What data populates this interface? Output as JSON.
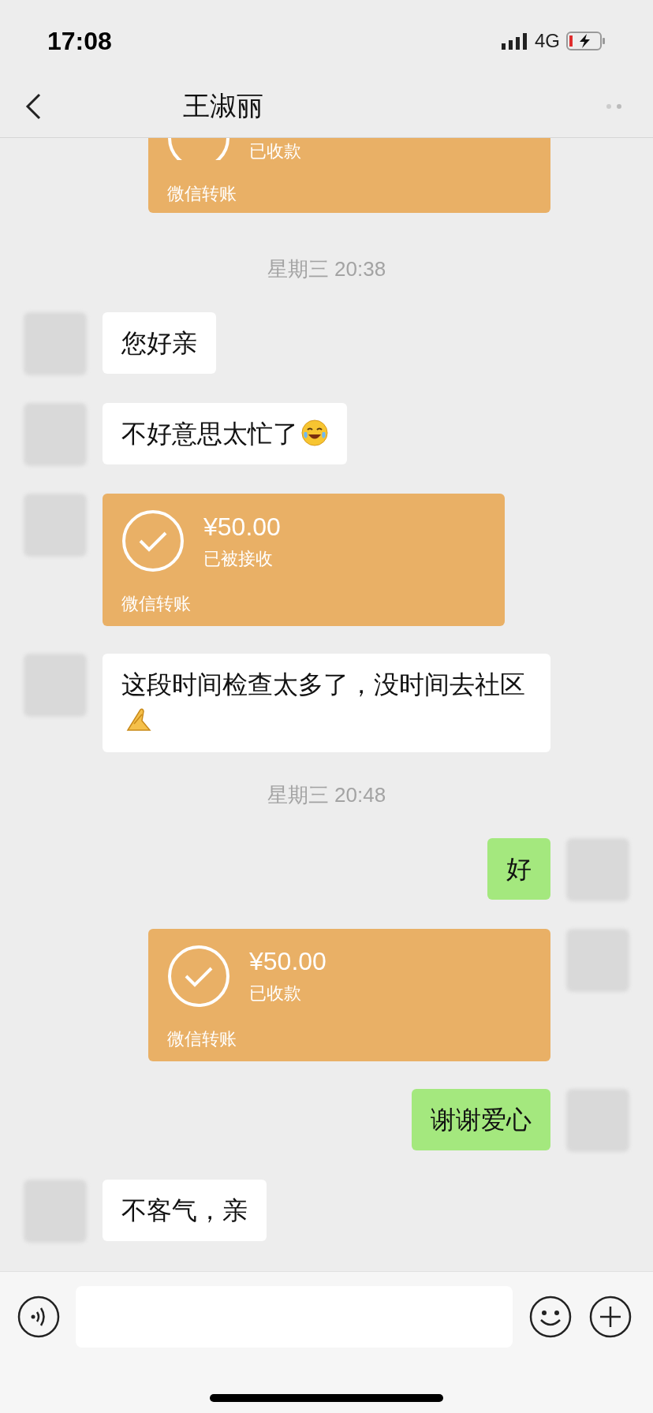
{
  "status_bar": {
    "time": "17:08",
    "network": "4G"
  },
  "nav": {
    "title": "王淑丽"
  },
  "top_card": {
    "status": "已收款",
    "label": "微信转账"
  },
  "messages": [
    {
      "kind": "time",
      "text": "星期三 20:38"
    },
    {
      "kind": "text",
      "outgoing": false,
      "text": "您好亲"
    },
    {
      "kind": "text",
      "outgoing": false,
      "text": "不好意思太忙了",
      "emoji": {
        "kind": "laugh"
      }
    },
    {
      "kind": "transfer",
      "outgoing": false,
      "amount": "¥50.00",
      "status": "已被接收",
      "label": "微信转账"
    },
    {
      "kind": "text",
      "outgoing": false,
      "text": "这段时间检查太多了，没时间去社区",
      "emoji": {
        "kind": "pray"
      }
    },
    {
      "kind": "time",
      "text": "星期三 20:48"
    },
    {
      "kind": "text",
      "outgoing": true,
      "text": "好"
    },
    {
      "kind": "transfer",
      "outgoing": true,
      "amount": "¥50.00",
      "status": "已收款",
      "label": "微信转账"
    },
    {
      "kind": "text",
      "outgoing": true,
      "text": "谢谢爱心"
    },
    {
      "kind": "text",
      "outgoing": false,
      "text": "不客气，亲"
    }
  ]
}
